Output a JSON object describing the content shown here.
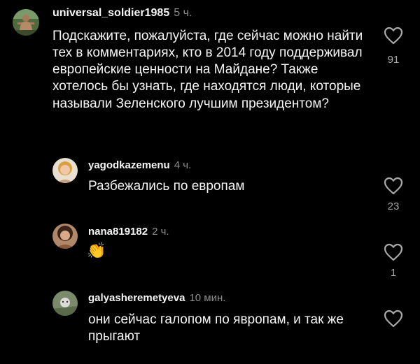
{
  "comments": [
    {
      "username": "universal_soldier1985",
      "time": "5 ч.",
      "text": "Подскажите, пожалуйста, где сейчас можно найти тех в комментариях, кто в 2014 году поддерживал европейские ценности на Майдане? Также хотелось бы узнать, где находятся люди, которые называли Зеленского лучшим президентом?",
      "likes": "91"
    },
    {
      "username": "yagodkazemenu",
      "time": "4 ч.",
      "text": "Разбежались по европам",
      "likes": "23"
    },
    {
      "username": "nana819182",
      "time": "2 ч.",
      "text": "👏",
      "likes": "1"
    },
    {
      "username": "galyasheremetyeva",
      "time": "10 мин.",
      "text": "они сейчас галопом по явропам, и так же прыгают",
      "likes": ""
    }
  ],
  "colors": {
    "background": "#000000",
    "text": "#f5f5f5",
    "secondary": "#8e8e8e",
    "like_outline": "#a8a8a8"
  },
  "icons": [
    "avatar",
    "heart-outline-icon",
    "clapping-hands-emoji"
  ]
}
